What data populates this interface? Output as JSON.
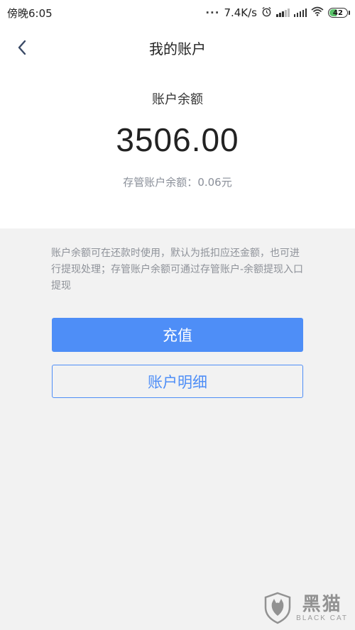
{
  "status_bar": {
    "time": "傍晚6:05",
    "network_speed": "7.4K/s",
    "battery": "42",
    "battery_level": 0.42,
    "icons": [
      "more-dots-icon",
      "alarm-icon",
      "signal-icon",
      "signal-icon",
      "wifi-icon",
      "battery-icon"
    ]
  },
  "nav": {
    "title": "我的账户",
    "back_icon": "chevron-left-icon"
  },
  "balance": {
    "label": "账户余额",
    "amount": "3506.00",
    "custody_label": "存管账户余额",
    "custody_separator": "：",
    "custody_value": "0.06元"
  },
  "notice": {
    "text": "账户余额可在还款时使用，默认为抵扣应还金额，也可进行提现处理；存管账户余额可通过存管账户-余额提现入口提现"
  },
  "actions": {
    "recharge_label": "充值",
    "detail_label": "账户明细"
  },
  "watermark": {
    "cn": "黑猫",
    "en": "BLACK CAT"
  },
  "colors": {
    "accent": "#4e8ef7",
    "background": "#f2f2f2",
    "card": "#ffffff",
    "muted_text": "#8e9299"
  }
}
